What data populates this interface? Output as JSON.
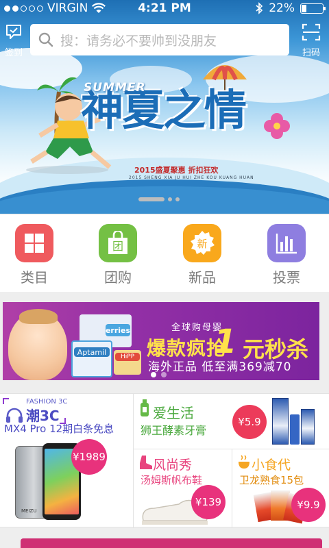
{
  "status": {
    "carrier": "VIRGIN",
    "time": "4:21 PM",
    "battery": "22%",
    "battery_level": 0.22
  },
  "header": {
    "checkin_label": "签到",
    "scan_label": "扫码",
    "search_placeholder": "搜：请务必不要帅到没朋友"
  },
  "hero": {
    "title": "神夏之情",
    "subtitle": "SUMMER",
    "caption": "2015盛夏聚惠 折扣狂欢",
    "caption_en": "2015 SHENG XIA JU HUI ZHE KOU KUANG HUAN",
    "slides": 3,
    "active_slide": 1
  },
  "categories": [
    {
      "label": "类目",
      "icon": "grid-icon",
      "color": "#ef5a5e"
    },
    {
      "label": "团购",
      "icon": "group-buy-bag-icon",
      "color": "#74c044",
      "glyph": "团"
    },
    {
      "label": "新品",
      "icon": "new-badge-icon",
      "color": "#f9a81c",
      "glyph": "新"
    },
    {
      "label": "投票",
      "icon": "bar-chart-icon",
      "color": "#8e7ee0"
    }
  ],
  "promo": {
    "tagline": "全球购母婴",
    "headline": "爆款疯抢",
    "highlight_num": "1",
    "highlight_text": "元秒杀",
    "sub": "海外正品 低至满369减70",
    "brand1": "Aptamil",
    "brand2": "erries",
    "brand3": "HiPP",
    "slides": 2,
    "active_slide": 1
  },
  "products": {
    "fashion3c": {
      "tag_en": "FASHION 3C",
      "title": "潮3C",
      "desc": "MX4 Pro 12期白条免息",
      "price": "¥1989",
      "brand": "MEIZU"
    },
    "life": {
      "title": "爱生活",
      "desc": "狮王酵素牙膏",
      "price": "¥5.9"
    },
    "style": {
      "title": "风尚秀",
      "desc": "汤姆斯帆布鞋",
      "price": "¥139"
    },
    "snack": {
      "title": "小食代",
      "desc": "卫龙熟食15包",
      "price": "¥9.9"
    }
  }
}
